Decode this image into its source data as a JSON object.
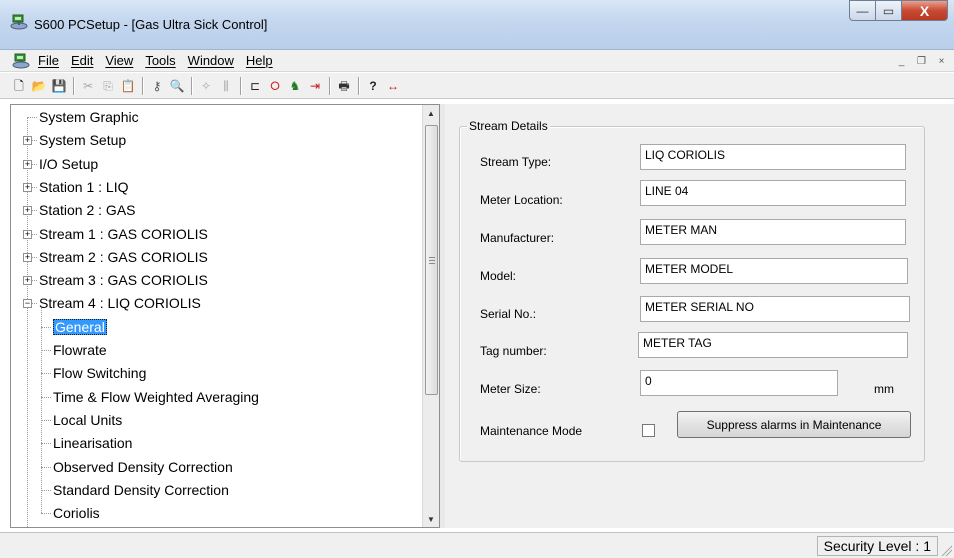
{
  "window": {
    "title": "S600 PCSetup  - [Gas Ultra Sick Control]",
    "minimize_glyph": "—",
    "maximize_glyph": "▭",
    "close_glyph": "X",
    "app_icon": "network-computer-icon"
  },
  "menu": {
    "items": [
      "File",
      "Edit",
      "View",
      "Tools",
      "Window",
      "Help"
    ],
    "mdi_minimize": "_",
    "mdi_restore": "❐",
    "mdi_close": "×"
  },
  "toolbar": {
    "icons": [
      {
        "name": "new-icon",
        "glyph": "🗋",
        "enabled": true
      },
      {
        "name": "open-icon",
        "glyph": "📂",
        "enabled": true
      },
      {
        "name": "save-icon",
        "glyph": "💾",
        "enabled": true
      },
      {
        "name": "cut-icon",
        "glyph": "✂",
        "enabled": false
      },
      {
        "name": "copy-icon",
        "glyph": "⎘",
        "enabled": false
      },
      {
        "name": "paste-icon",
        "glyph": "📋",
        "enabled": false
      },
      {
        "name": "key-icon",
        "glyph": "⚷",
        "enabled": true
      },
      {
        "name": "find-icon",
        "glyph": "🔍",
        "enabled": true
      },
      {
        "name": "wizard-icon",
        "glyph": "✧",
        "enabled": false
      },
      {
        "name": "tune-icon",
        "glyph": "⫼",
        "enabled": false
      },
      {
        "name": "connect-icon",
        "glyph": "⊏",
        "enabled": true
      },
      {
        "name": "stop-icon",
        "glyph": "⭘",
        "enabled": true
      },
      {
        "name": "transfer-icon",
        "glyph": "♞",
        "enabled": true
      },
      {
        "name": "send-icon",
        "glyph": "⇥",
        "enabled": true
      },
      {
        "name": "print-icon",
        "glyph": "🖶",
        "enabled": true
      },
      {
        "name": "help-icon",
        "glyph": "?",
        "enabled": true
      },
      {
        "name": "context-help-icon",
        "glyph": "↔",
        "enabled": true
      }
    ]
  },
  "tree": {
    "nodes": [
      {
        "label": "System Graphic",
        "expander": "",
        "level": 0
      },
      {
        "label": "System Setup",
        "expander": "+",
        "level": 0
      },
      {
        "label": "I/O Setup",
        "expander": "+",
        "level": 0
      },
      {
        "label": "Station 1 : LIQ",
        "expander": "+",
        "level": 0
      },
      {
        "label": "Station 2 : GAS",
        "expander": "+",
        "level": 0
      },
      {
        "label": "Stream 1 : GAS CORIOLIS",
        "expander": "+",
        "level": 0
      },
      {
        "label": "Stream 2 : GAS CORIOLIS",
        "expander": "+",
        "level": 0
      },
      {
        "label": "Stream 3 : GAS CORIOLIS",
        "expander": "+",
        "level": 0
      },
      {
        "label": "Stream 4 : LIQ CORIOLIS",
        "expander": "−",
        "level": 0
      },
      {
        "label": "General",
        "expander": "",
        "level": 1,
        "selected": true
      },
      {
        "label": "Flowrate",
        "expander": "",
        "level": 1
      },
      {
        "label": "Flow Switching",
        "expander": "",
        "level": 1
      },
      {
        "label": "Time & Flow Weighted Averaging",
        "expander": "",
        "level": 1
      },
      {
        "label": "Local Units",
        "expander": "",
        "level": 1
      },
      {
        "label": "Linearisation",
        "expander": "",
        "level": 1
      },
      {
        "label": "Observed Density Correction",
        "expander": "",
        "level": 1
      },
      {
        "label": "Standard Density Correction",
        "expander": "",
        "level": 1
      },
      {
        "label": "Coriolis",
        "expander": "",
        "level": 1
      }
    ],
    "scroll_up": "▲",
    "scroll_down": "▼"
  },
  "stream_details": {
    "group_title": "Stream Details",
    "fields": [
      {
        "label": "Stream Type:",
        "value": "LIQ CORIOLIS"
      },
      {
        "label": "Meter Location:",
        "value": "LINE 04"
      },
      {
        "label": "Manufacturer:",
        "value": "METER MAN"
      },
      {
        "label": "Model:",
        "value": "METER MODEL"
      },
      {
        "label": "Serial No.:",
        "value": "METER SERIAL NO"
      },
      {
        "label": "Tag number:",
        "value": "METER TAG"
      },
      {
        "label": "Meter Size:",
        "value": "0"
      }
    ],
    "meter_size_unit": "mm",
    "maintenance_label": "Maintenance Mode",
    "maintenance_checked": false,
    "suppress_button": "Suppress alarms in Maintenance"
  },
  "status": {
    "security_level": "Security Level : 1"
  }
}
